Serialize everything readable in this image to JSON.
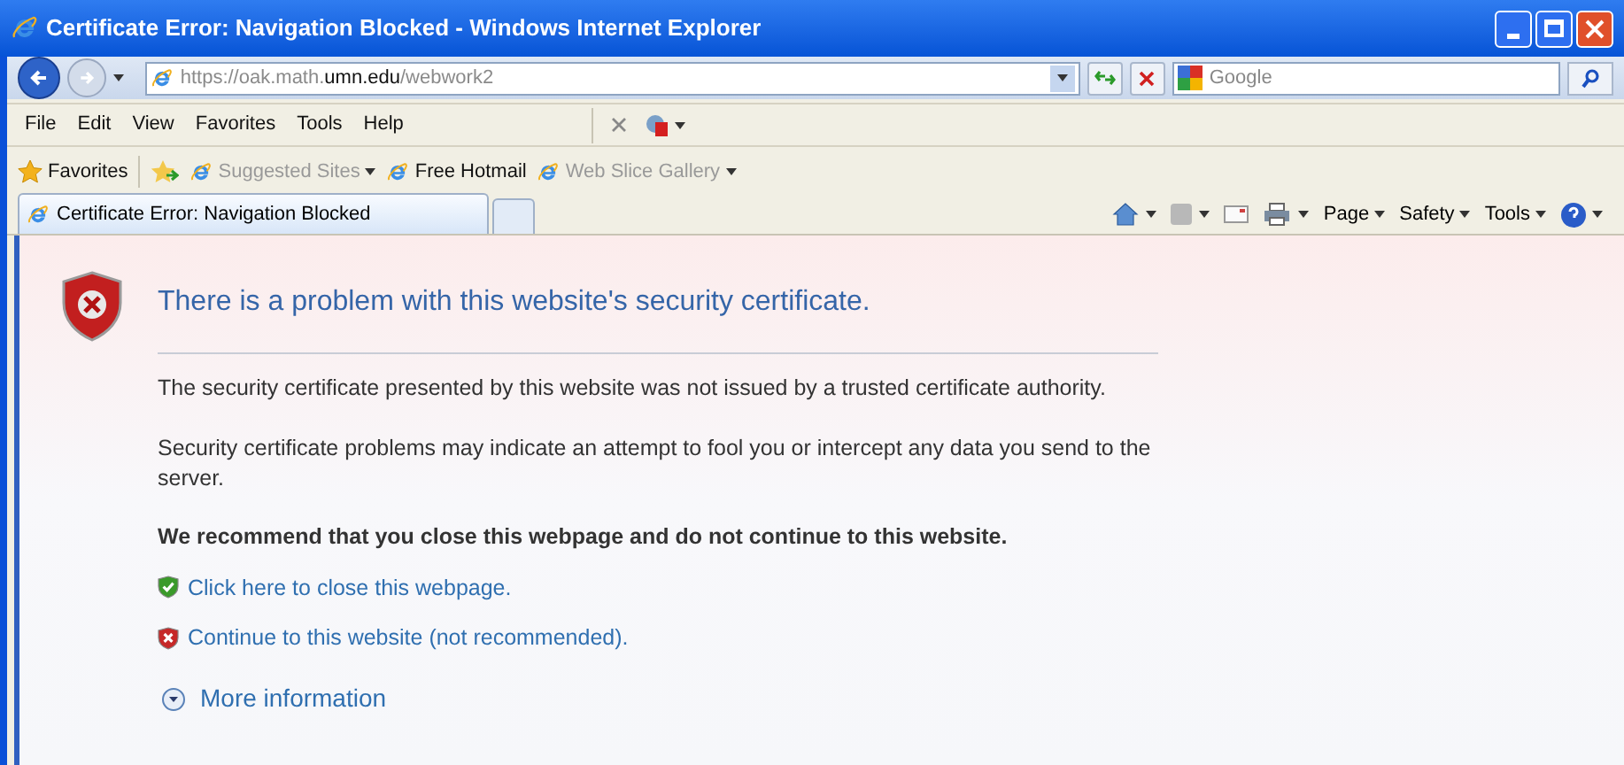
{
  "window": {
    "title": "Certificate Error: Navigation Blocked - Windows Internet Explorer"
  },
  "address": {
    "prefix": "https://oak.math.",
    "domain": "umn.edu",
    "suffix": "/webwork2"
  },
  "search": {
    "placeholder": "Google"
  },
  "menu": [
    "File",
    "Edit",
    "View",
    "Favorites",
    "Tools",
    "Help"
  ],
  "favorites_bar": {
    "label": "Favorites",
    "items": [
      {
        "label": "Suggested Sites",
        "disabled": true,
        "dropdown": true
      },
      {
        "label": "Free Hotmail",
        "disabled": false,
        "dropdown": false
      },
      {
        "label": "Web Slice Gallery",
        "disabled": true,
        "dropdown": true
      }
    ]
  },
  "tabs": [
    {
      "label": "Certificate Error: Navigation Blocked",
      "selected": true
    }
  ],
  "command_bar": [
    "Page",
    "Safety",
    "Tools"
  ],
  "page": {
    "heading": "There is a problem with this website's security certificate.",
    "paragraphs": [
      "The security certificate presented by this website was not issued by a trusted certificate authority.",
      "Security certificate problems may indicate an attempt to fool you or intercept any data you send to the server."
    ],
    "recommendation": "We recommend that you close this webpage and do not continue to this website.",
    "links": [
      {
        "kind": "safe",
        "label": "Click here to close this webpage."
      },
      {
        "kind": "unsafe",
        "label": "Continue to this website (not recommended)."
      }
    ],
    "more": "More information"
  }
}
